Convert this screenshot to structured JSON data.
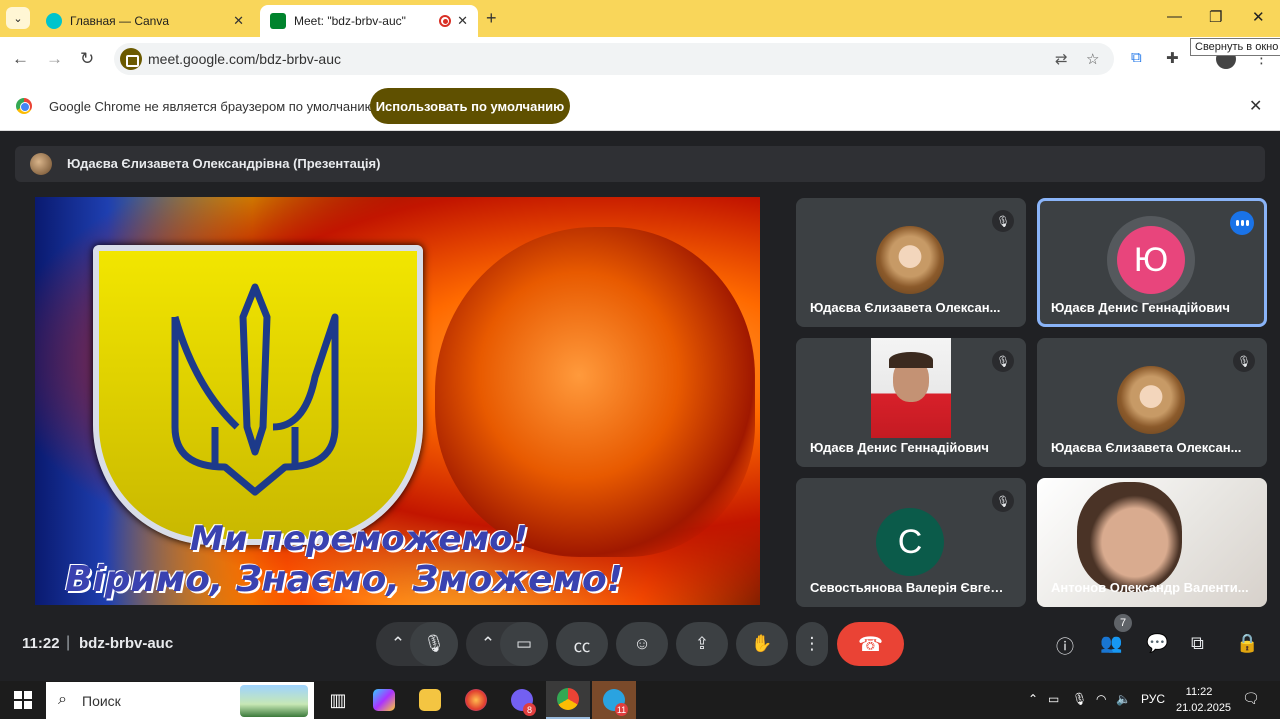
{
  "browser": {
    "tabs": [
      {
        "title": "Главная — Canva",
        "favicon_color": "#00c4cc"
      },
      {
        "title": "Meet: \"bdz-brbv-auc\"",
        "favicon_color": "#00832d"
      }
    ],
    "tooltip": "Свернуть в окно",
    "url": "meet.google.com/bdz-brbv-auc",
    "infobar": {
      "text": "Google Chrome не является браузером по умолчанию.",
      "button": "Использовать по умолчанию"
    }
  },
  "meet": {
    "presenter_label": "Юдаєва Єлизавета Олександрівна (Презентація)",
    "slide": {
      "line1": "Ми переможемо!",
      "line2": "Віримо, Знаємо, Зможемо!"
    },
    "tiles": [
      {
        "name": "Юдаєва Єлизавета Олексан...",
        "muted": true,
        "avatar": "photo"
      },
      {
        "name": "Юдаєв Денис Геннадійович",
        "speaking": true,
        "avatar_letter": "Ю",
        "avatar_color": "#e8457c"
      },
      {
        "name": "Юдаєв Денис Геннадійович",
        "muted": true,
        "avatar": "video"
      },
      {
        "name": "Юдаєва Єлизавета Олексан...",
        "muted": true,
        "avatar": "photo"
      },
      {
        "name": "Севостьянова Валерія Євгені...",
        "muted": true,
        "avatar_letter": "С",
        "avatar_color": "#0b5b4a"
      },
      {
        "name": "Антонов Олександр Валенти...",
        "avatar": "video"
      }
    ],
    "bottom": {
      "time": "11:22",
      "meeting_code": "bdz-brbv-auc",
      "people_count": "7"
    }
  },
  "taskbar": {
    "search_placeholder": "Поиск",
    "badges": {
      "viber": "8",
      "telegram": "11"
    },
    "language": "РУС",
    "time": "11:22",
    "date": "21.02.2025"
  }
}
